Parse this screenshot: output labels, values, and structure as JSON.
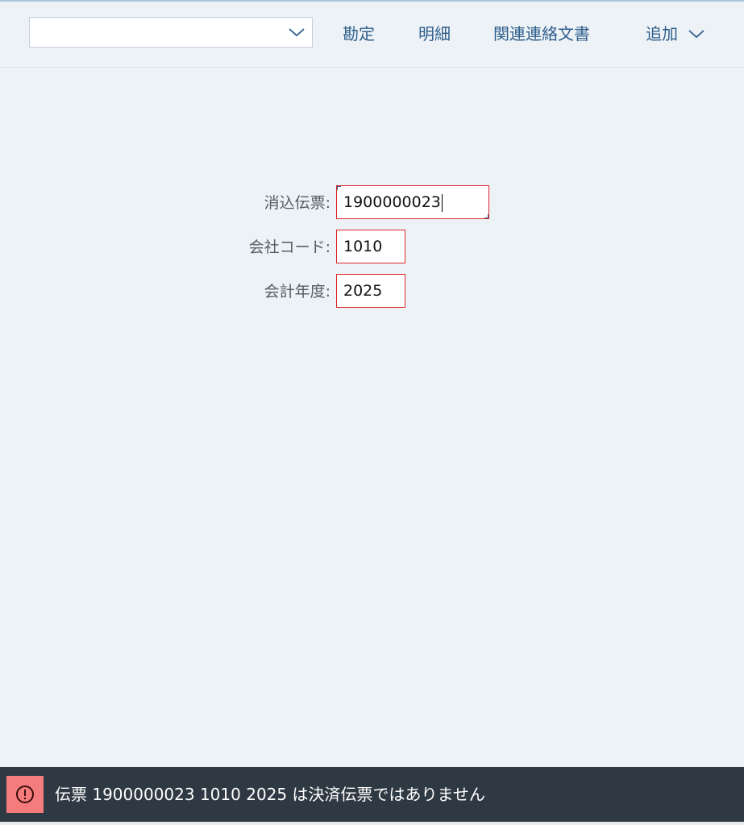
{
  "toolbar": {
    "variant_value": "",
    "buttons": [
      {
        "label": "勘定"
      },
      {
        "label": "明細"
      },
      {
        "label": "関連連絡文書"
      }
    ],
    "more_label": "追加"
  },
  "form": {
    "fields": [
      {
        "label": "消込伝票:",
        "value": "1900000023"
      },
      {
        "label": "会社コード:",
        "value": "1010"
      },
      {
        "label": "会計年度:",
        "value": "2025"
      }
    ]
  },
  "status": {
    "type": "error",
    "icon": "error-icon",
    "message": "伝票 1900000023 1010 2025 は決済伝票ではありません"
  },
  "colors": {
    "accent": "#2d5d8a",
    "error_border": "#e0262b",
    "status_bg": "#2f3943",
    "error_icon_bg": "#f47c7c"
  }
}
